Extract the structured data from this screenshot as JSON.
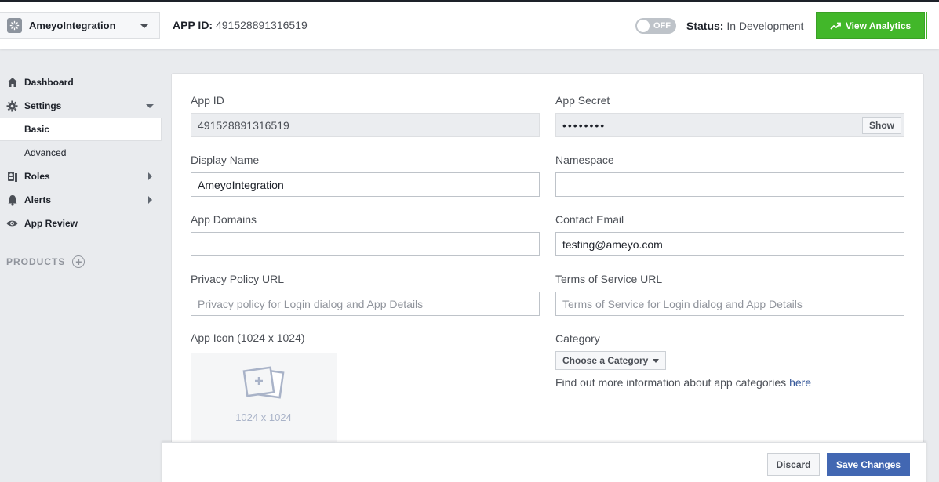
{
  "topbar": {
    "app_name": "AmeyoIntegration",
    "app_id_label": "APP ID:",
    "app_id_value": "491528891316519",
    "toggle_label": "OFF",
    "status_label": "Status:",
    "status_value": "In Development",
    "analytics_label": "View Analytics"
  },
  "sidebar": {
    "dashboard": "Dashboard",
    "settings": "Settings",
    "basic": "Basic",
    "advanced": "Advanced",
    "roles": "Roles",
    "alerts": "Alerts",
    "app_review": "App Review",
    "products": "PRODUCTS"
  },
  "form": {
    "app_id": {
      "label": "App ID",
      "value": "491528891316519"
    },
    "app_secret": {
      "label": "App Secret",
      "value": "••••••••",
      "show_label": "Show"
    },
    "display_name": {
      "label": "Display Name",
      "value": "AmeyoIntegration"
    },
    "namespace": {
      "label": "Namespace",
      "value": ""
    },
    "app_domains": {
      "label": "App Domains",
      "value": ""
    },
    "contact_email": {
      "label": "Contact Email",
      "value": "testing@ameyo.com"
    },
    "privacy_url": {
      "label": "Privacy Policy URL",
      "placeholder": "Privacy policy for Login dialog and App Details"
    },
    "tos_url": {
      "label": "Terms of Service URL",
      "placeholder": "Terms of Service for Login dialog and App Details"
    },
    "app_icon": {
      "label": "App Icon (1024 x 1024)",
      "placeholder": "1024 x 1024"
    },
    "category": {
      "label": "Category",
      "button": "Choose a Category",
      "info": "Find out more information about app categories",
      "link": "here"
    }
  },
  "footer": {
    "discard": "Discard",
    "save": "Save Changes"
  },
  "colors": {
    "primary": "#4267b2",
    "success": "#42b72a",
    "link": "#365899"
  }
}
